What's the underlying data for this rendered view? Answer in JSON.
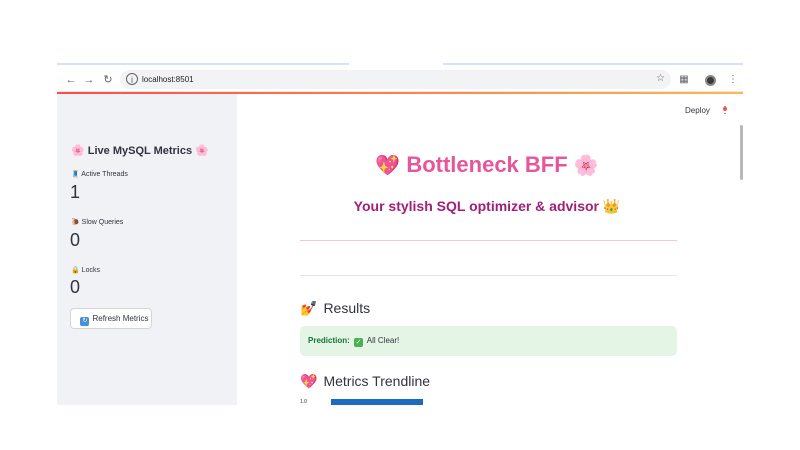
{
  "browser": {
    "url": "localhost:8501",
    "icons": {
      "back": "arrow-left-icon",
      "forward": "arrow-right-icon",
      "reload": "reload-icon",
      "info": "info-icon",
      "star": "star-icon",
      "extensions": "puzzle-icon",
      "avatar": "avatar-icon",
      "menu": "kebab-menu-icon"
    }
  },
  "sidebar": {
    "title": "Live MySQL Metrics",
    "title_emoji_left": "🌸",
    "title_emoji_right": "🌸",
    "metrics": [
      {
        "icon": "🧵",
        "label": "Active Threads",
        "value": "1"
      },
      {
        "icon": "🐌",
        "label": "Slow Queries",
        "value": "0"
      },
      {
        "icon": "🔒",
        "label": "Locks",
        "value": "0"
      }
    ],
    "refresh_label": "Refresh Metrics",
    "refresh_icon": "🔄"
  },
  "header": {
    "deploy_label": "Deploy"
  },
  "main": {
    "title": "Bottleneck BFF",
    "title_emoji_left": "💖",
    "title_emoji_right": "🌸",
    "subtitle": "Your stylish SQL optimizer & advisor",
    "subtitle_emoji": "👑",
    "results_heading": "Results",
    "results_emoji": "💅",
    "prediction_label": "Prediction:",
    "prediction_icon": "✅",
    "prediction_value": "All Clear!",
    "trend_heading": "Metrics Trendline",
    "trend_emoji": "💖",
    "trend_first_tick": "1.0"
  },
  "colors": {
    "accent_pink": "#e5569b",
    "subtitle_purple": "#a01f78",
    "success_bg": "#e4f5e6",
    "success_text": "#177233",
    "sidebar_bg": "#f0f2f6",
    "chart_bar": "#1c6bbf"
  }
}
